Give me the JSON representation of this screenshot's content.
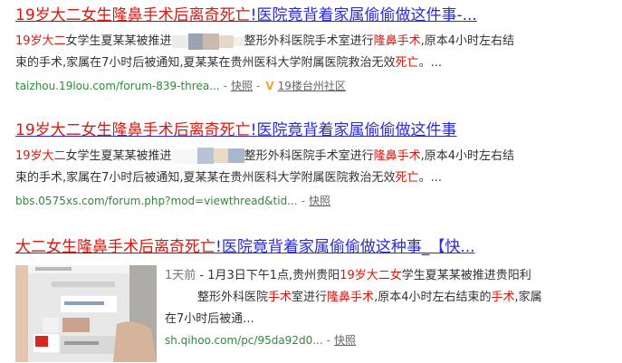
{
  "results": [
    {
      "title": {
        "pre": "19岁大二女生隆鼻手术后离奇死亡",
        "post": "!医院竟背着家属偷偷做这件事-..."
      },
      "abstract": {
        "l1_a": "19岁大二",
        "l1_b": "女学生夏某某被推进",
        "l1_c": "整形外科医院手术室进行",
        "l1_d": "隆鼻手术",
        "l1_e": ",原本4小时左右结",
        "l2_a": "束的手术,家属在7小时后被通知,夏某某在贵州医科大学附属医院救治无效",
        "l2_b": "死亡",
        "l2_c": "。..."
      },
      "url": "taizhou.19lou.com/forum-839-threa...",
      "snapshot": "快照",
      "badge": "V",
      "site": "19楼台州社区"
    },
    {
      "title": {
        "pre": "19岁大二女生隆鼻手术后离奇死亡",
        "post": "!医院竟背着家属偷偷做这件事"
      },
      "abstract": {
        "l1_a": "19岁大二",
        "l1_b": "女学生夏某某被推进",
        "l1_c": "整形外科医院手术室进行",
        "l1_d": "隆鼻手术",
        "l1_e": ",原本4小时左右结",
        "l2_a": "束的手术,家属在7小时后被通知,夏某某在贵州医科大学附属医院救治无效",
        "l2_b": "死亡",
        "l2_c": "。..."
      },
      "url": "bbs.0575xs.com/forum.php?mod=viewthread&tid...",
      "snapshot": "快照"
    },
    {
      "title": {
        "pre": "大二女生隆鼻手术后离奇死亡",
        "post": "!医院竟背着家属偷偷做这种事_【快..."
      },
      "abstract": {
        "time": "1天前",
        "l1_a": " - 1月3日下午1点,贵州贵阳",
        "l1_b": "19岁大二女",
        "l1_c": "学生夏某某被推进贵阳利",
        "l2_a": "整形外科医院",
        "l2_b": "手术",
        "l2_c": "室进行",
        "l2_d": "隆鼻手术",
        "l2_e": ",原本4小时左右结束的",
        "l2_f": "手术",
        "l2_g": ",家属",
        "l3": "在7小时后被通..."
      },
      "url": "sh.qihoo.com/pc/95da92d0...",
      "snapshot": "快照"
    }
  ],
  "colors": {
    "link": "#2a2ad9",
    "highlight": "#d9180e",
    "url": "#2e8a3a",
    "text": "#333333"
  }
}
